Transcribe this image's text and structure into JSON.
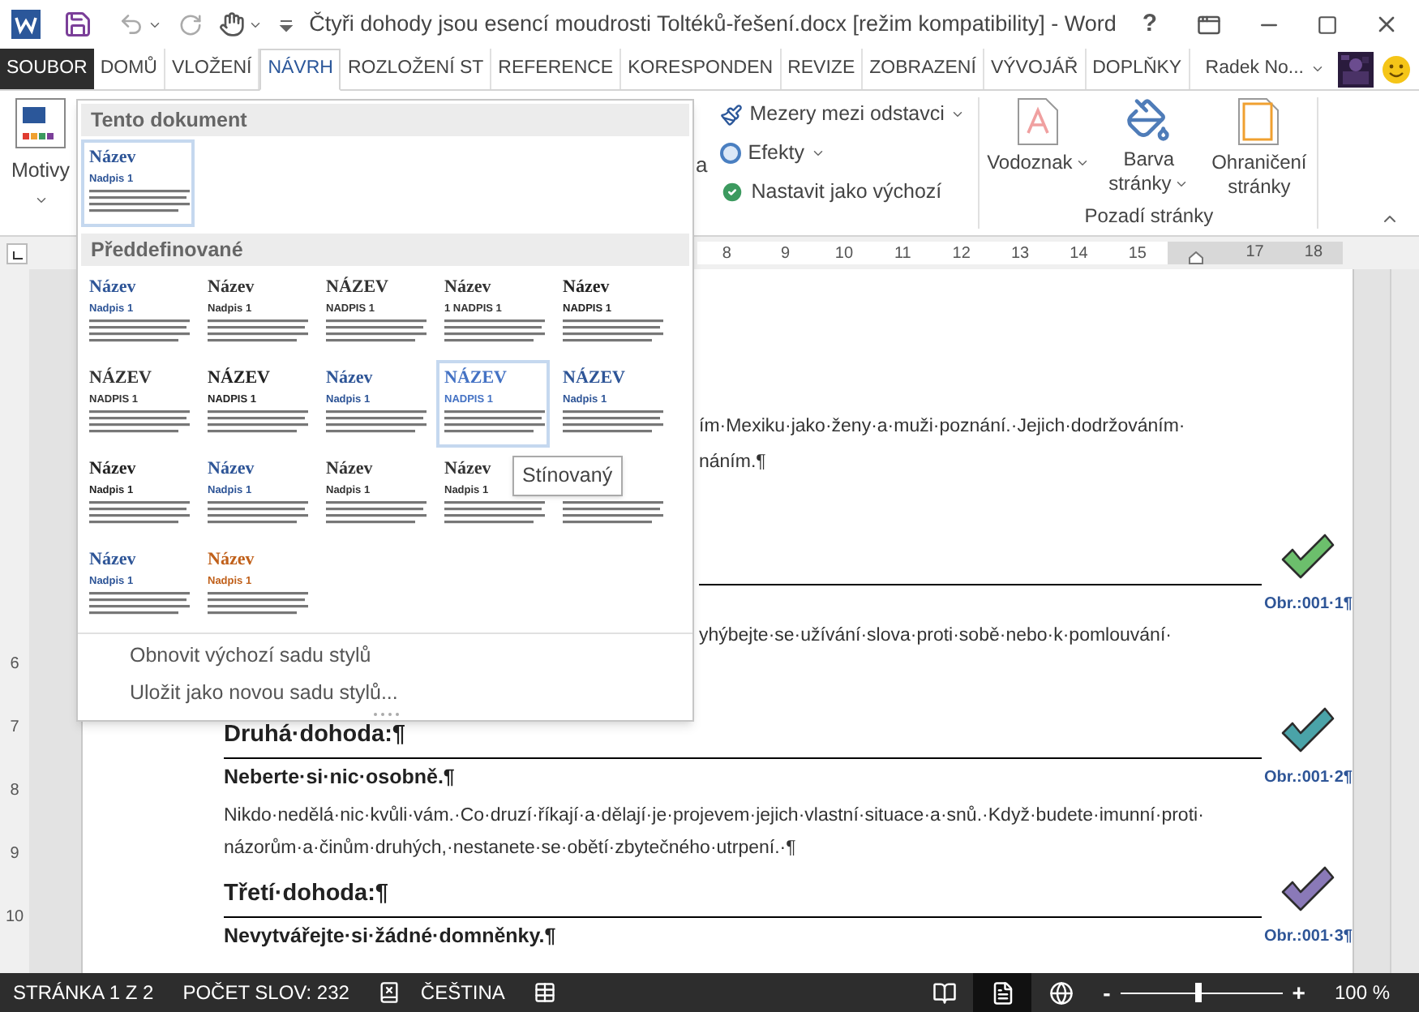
{
  "window": {
    "title": "Čtyři dohody jsou esencí moudrosti Toltéků-řešení.docx [režim kompatibility] - Word",
    "help": "?"
  },
  "tabs": [
    {
      "label": "SOUBOR",
      "kind": "file",
      "selected": false
    },
    {
      "label": "DOMŮ",
      "kind": "tab",
      "selected": false
    },
    {
      "label": "VLOŽENÍ",
      "kind": "tab",
      "selected": false
    },
    {
      "label": "NÁVRH",
      "kind": "tab",
      "selected": true
    },
    {
      "label": "ROZLOŽENÍ ST",
      "kind": "tab",
      "selected": false
    },
    {
      "label": "REFERENCE",
      "kind": "tab",
      "selected": false
    },
    {
      "label": "KORESPONDEN",
      "kind": "tab",
      "selected": false
    },
    {
      "label": "REVIZE",
      "kind": "tab",
      "selected": false
    },
    {
      "label": "ZOBRAZENÍ",
      "kind": "tab",
      "selected": false
    },
    {
      "label": "VÝVOJÁŘ",
      "kind": "tab",
      "selected": false
    },
    {
      "label": "DOPLŇKY",
      "kind": "tab",
      "selected": false
    }
  ],
  "account": {
    "name": "Radek No..."
  },
  "ribbon": {
    "themes_button": "Motivy",
    "fragment": "a",
    "format_commands": [
      {
        "label": "Mezery mezi odstavci",
        "dropdown": true
      },
      {
        "label": "Efekty",
        "dropdown": true
      },
      {
        "label": "Nastavit jako výchozí",
        "dropdown": false
      }
    ],
    "page_background": {
      "label": "Pozadí stránky",
      "buttons": [
        {
          "label": "Vodoznak",
          "kind": "watermark",
          "dropdown": true
        },
        {
          "label": "Barva stránky",
          "kind": "color",
          "dropdown": true
        },
        {
          "label": "Ohraničení stránky",
          "kind": "border",
          "dropdown": false
        }
      ]
    }
  },
  "ruler": {
    "numbers_before_indent": [
      "8",
      "9",
      "10",
      "11",
      "12",
      "13",
      "14",
      "15"
    ],
    "numbers_after_indent": [
      "17",
      "18"
    ],
    "vertical_numbers": [
      "6",
      "7",
      "8",
      "9",
      "10"
    ]
  },
  "styles_gallery": {
    "sections": [
      {
        "header": "Tento dokument",
        "thumbnails": [
          {
            "title": "Název",
            "heading": "Nadpis 1",
            "color": "#2e5597",
            "selected": true
          }
        ]
      },
      {
        "header": "Předdefinované",
        "thumbnails": [
          {
            "title": "Název",
            "heading": "Nadpis 1",
            "color": "#2e5597",
            "selected": false
          },
          {
            "title": "Název",
            "heading": "Nadpis 1",
            "color": "#333333",
            "selected": false
          },
          {
            "title": "NÁZEV",
            "heading": "NADPIS 1",
            "color": "#333333",
            "selected": false
          },
          {
            "title": "Název",
            "heading": "1 NADPIS 1",
            "color": "#333333",
            "selected": false
          },
          {
            "title": "Název",
            "heading": "NADPIS 1",
            "color": "#222222",
            "selected": false
          },
          {
            "title": "NÁZEV",
            "heading": "NADPIS 1",
            "color": "#333333",
            "selected": false
          },
          {
            "title": "NÁZEV",
            "heading": "NADPIS 1",
            "color": "#222222",
            "selected": false
          },
          {
            "title": "Název",
            "heading": "Nadpis 1",
            "color": "#2e5597",
            "selected": false
          },
          {
            "title": "NÁZEV",
            "heading": "NADPIS 1",
            "color": "#4472c4",
            "selected": true
          },
          {
            "title": "NÁZEV",
            "heading": "Nadpis 1",
            "color": "#2e5597",
            "selected": false
          },
          {
            "title": "Název",
            "heading": "Nadpis 1",
            "color": "#222222",
            "selected": false
          },
          {
            "title": "Název",
            "heading": "Nadpis 1",
            "color": "#2e5597",
            "selected": false
          },
          {
            "title": "Název",
            "heading": "Nadpis 1",
            "color": "#333333",
            "selected": false
          },
          {
            "title": "Název",
            "heading": "Nadpis 1",
            "color": "#333333",
            "selected": false
          },
          {
            "selected": false
          },
          {
            "title": "Název",
            "heading": "Nadpis 1",
            "color": "#2e5597",
            "selected": false
          },
          {
            "title": "Název",
            "heading": "Nadpis 1",
            "color": "#c0601a",
            "selected": false
          }
        ]
      }
    ],
    "commands": [
      {
        "label": "Obnovit výchozí sadu stylů"
      },
      {
        "label": "Uložit jako novou sadu stylů..."
      }
    ],
    "tooltip": "Stínovaný"
  },
  "document": {
    "blocks": [
      {
        "kind": "fragment",
        "text": "ím·Mexiku·jako·ženy·a·muži·poznání.·Jejich·dodržováním·"
      },
      {
        "kind": "fragment",
        "text": "náním.¶"
      },
      {
        "kind": "heading",
        "color": "#6cbf6c",
        "caption": "Obr.:001·1¶"
      },
      {
        "kind": "fragment",
        "text": "yhýbejte·se·užívání·slova·proti·sobě·nebo·k·pomlouvání·"
      },
      {
        "kind": "heading",
        "text": "Druhá·dohoda:¶",
        "color": "#4aa3a8",
        "subheading": "Neberte·si·nic·osobně.¶",
        "caption": "Obr.:001·2¶"
      },
      {
        "kind": "paragraph",
        "text": "Nikdo·nedělá·nic·kvůli·vám.·Co·druzí·říkají·a·dělají·je·projevem·jejich·vlastní·situace·a·snů.·Když·budete·imunní·proti·názorům·a·činům·druhých,·nestanete·se·obětí·zbytečného·utrpení.·¶"
      },
      {
        "kind": "heading",
        "text": "Třetí·dohoda:¶",
        "color": "#8a79b8",
        "subheading": "Nevytvářejte·si·žádné·domněnky.¶",
        "caption": "Obr.:001·3¶"
      }
    ]
  },
  "status_bar": {
    "page": "STRÁNKA 1 Z 2",
    "words": "POČET SLOV: 232",
    "language": "ČEŠTINA",
    "views": [
      {
        "kind": "read",
        "selected": false
      },
      {
        "kind": "print",
        "selected": true
      },
      {
        "kind": "web",
        "selected": false
      }
    ],
    "zoom_out": "-",
    "zoom_in": "+",
    "zoom": {
      "level": 0.48
    },
    "zoom_label": "100 %"
  }
}
